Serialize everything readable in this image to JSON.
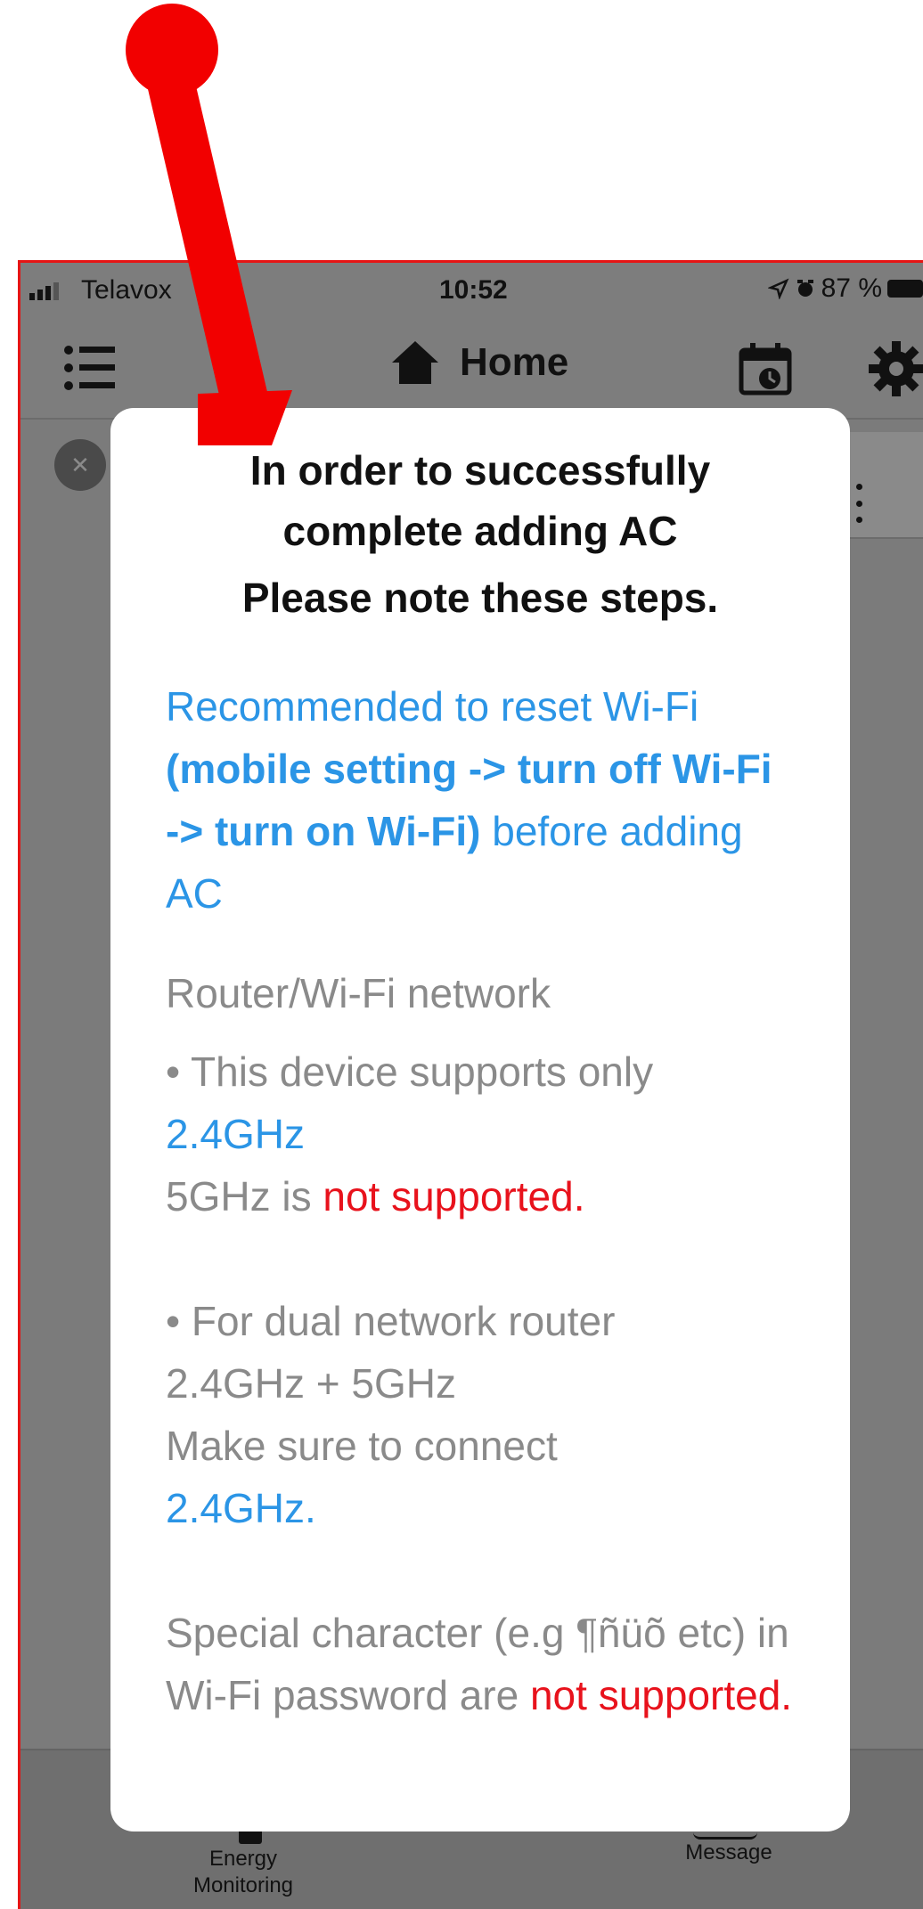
{
  "status_bar": {
    "carrier": "Telavox",
    "time": "10:52",
    "battery": "87 %"
  },
  "nav": {
    "title": "Home"
  },
  "modal": {
    "title_line1": "In order to successfully",
    "title_line2": "complete adding AC",
    "subtitle": "Please note these steps.",
    "reset": {
      "part1": "Recommended to reset Wi-Fi ",
      "bold": "(mobile setting -> turn off Wi-Fi -> turn on Wi-Fi)",
      "part2": " before adding AC"
    },
    "router_heading": "Router/Wi-Fi network",
    "point1": {
      "text": "• This device supports only ",
      "freq": "2.4GHz",
      "line2_prefix": "5GHz is ",
      "line2_red": "not supported."
    },
    "point2": {
      "line1": "• For dual network router",
      "line2": "2.4GHz + 5GHz",
      "line3": "Make sure to connect",
      "freq": "2.4GHz."
    },
    "special": {
      "text": "Special character (e.g ¶ñüõ etc) in Wi-Fi password are ",
      "red": "not supported."
    }
  },
  "tabs": {
    "energy": "Energy Monitoring",
    "message": "Message"
  },
  "colors": {
    "accent_blue": "#2b95e6",
    "warning_red": "#e8121c",
    "annotation_red": "#f20000"
  }
}
